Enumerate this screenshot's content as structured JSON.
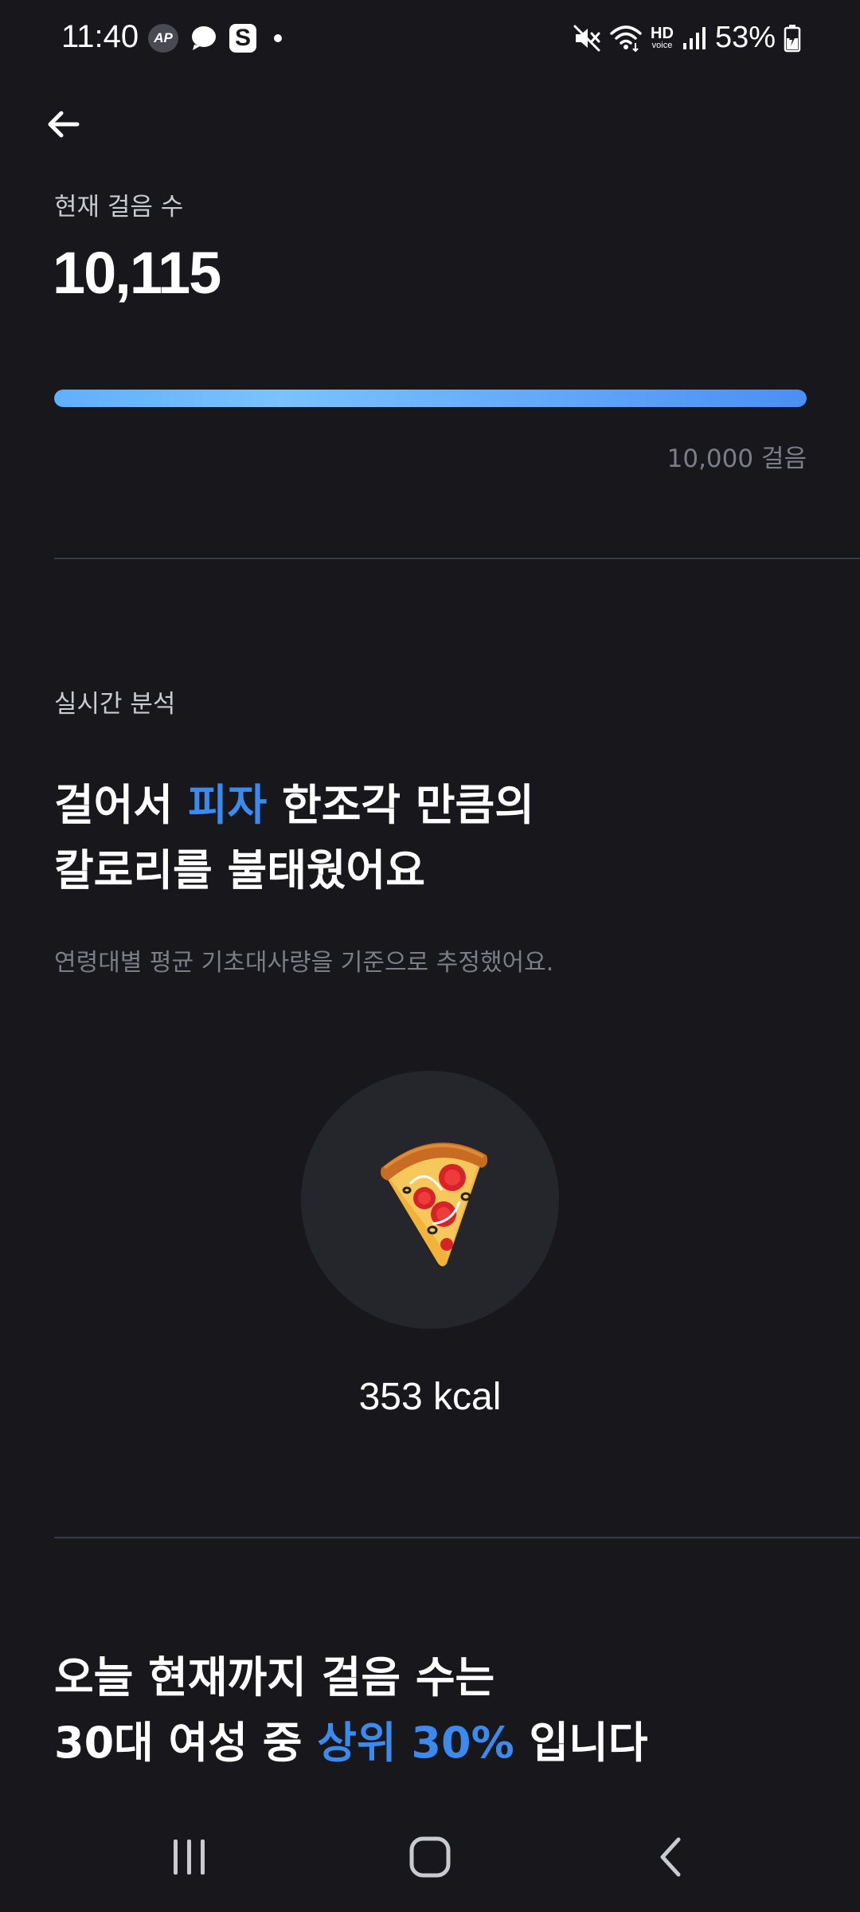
{
  "status_bar": {
    "time": "11:40",
    "left_icons": [
      "ap-icon",
      "chat-bubble-icon",
      "s-app-icon",
      "notification-dot-icon"
    ],
    "right_icons": [
      "mute-icon",
      "wifi-icon",
      "hd-voice-icon",
      "signal-icon",
      "battery-charging-icon"
    ],
    "hd_label": "HD",
    "voice_label": "voice",
    "battery": "53%"
  },
  "header": {
    "back_icon": "arrow-left-icon"
  },
  "steps": {
    "label": "현재 걸음 수",
    "value": "10,115",
    "progress": 1.0,
    "goal": "10,000 걸음"
  },
  "analysis": {
    "section_label": "실시간 분석",
    "headline_1_a": "걸어서 ",
    "headline_1_accent": "피자",
    "headline_1_b": " 한조각 만큼의",
    "headline_2": "칼로리를 불태웠어요",
    "note": "연령대별 평균 기초대사량을 기준으로 추정했어요.",
    "food_icon": "pizza-icon",
    "kcal": "353 kcal"
  },
  "ranking": {
    "line_1": "오늘 현재까지 걸음 수는",
    "line_2_a": "30대 여성 중 ",
    "line_2_accent": "상위 30%",
    "line_2_b": " 입니다"
  },
  "nav": {
    "icons": [
      "recent-apps-icon",
      "home-icon",
      "back-icon"
    ]
  },
  "colors": {
    "background": "#17171c",
    "accent": "#3b8af0",
    "muted_text": "#7b7e87",
    "secondary_text": "#c9cbd1"
  }
}
